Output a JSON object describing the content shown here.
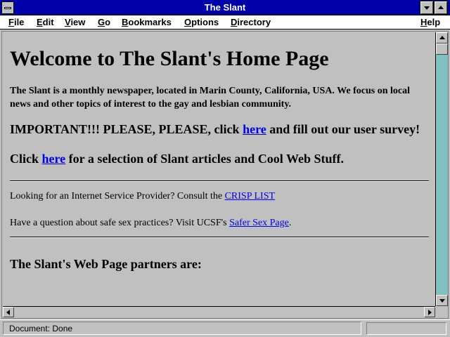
{
  "window": {
    "title": "The Slant"
  },
  "menu": {
    "items": [
      "File",
      "Edit",
      "View",
      "Go",
      "Bookmarks",
      "Options",
      "Directory",
      "Help"
    ]
  },
  "page": {
    "heading": "Welcome to The Slant's Home Page",
    "intro": "The Slant is a monthly newspaper, located in Marin County, California, USA. We focus on local news and other topics of interest to the gay and lesbian community.",
    "important_pre": "IMPORTANT!!! PLEASE, PLEASE, click ",
    "important_link": "here",
    "important_post": " and fill out our user survey!",
    "click_pre": "Click ",
    "click_link": "here",
    "click_post": " for a selection of Slant articles and Cool Web Stuff.",
    "isp_pre": "Looking for an Internet Service Provider? Consult the ",
    "isp_link": "CRISP LIST",
    "safe_pre": "Have a question about safe sex practices? Visit UCSF's ",
    "safe_link": "Safer Sex Page",
    "safe_post": ".",
    "partners_heading": "The Slant's Web Page partners are:"
  },
  "status": {
    "text": "Document: Done"
  },
  "colors": {
    "titlebar": "#0000a8",
    "link": "#0000ee",
    "scroll_track": "#80c0c0"
  }
}
